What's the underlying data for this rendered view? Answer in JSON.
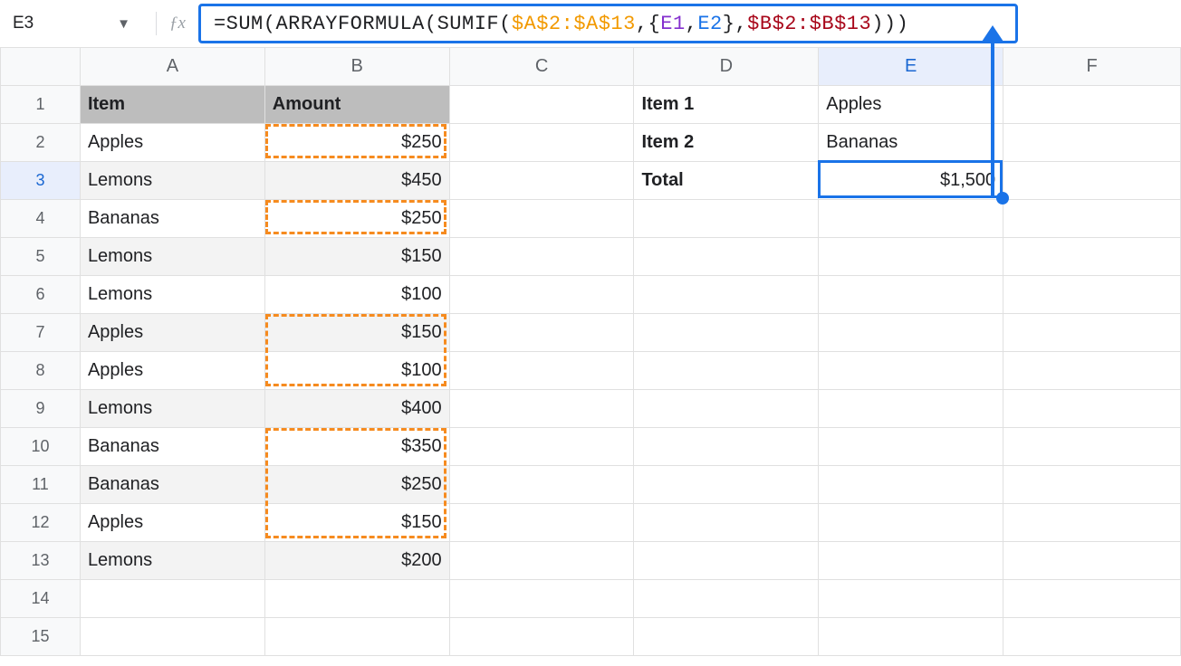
{
  "namebox": {
    "cell": "E3",
    "dropdown": "▼"
  },
  "formula": {
    "eq": "=",
    "sum": "SUM",
    "lp1": "(",
    "af": "ARRAYFORMULA",
    "lp2": "(",
    "sumif": "SUMIF",
    "lp3": "(",
    "r1": "$A$2:$A$13",
    "c1": ",",
    "sp1": " ",
    "lb": "{",
    "r2": "E1",
    "c2": ",",
    "r3": "E2",
    "rb": "}",
    "c3": ",",
    "sp2": " ",
    "r4": "$B$2:$B$13",
    "rp": ")))"
  },
  "columns": [
    "A",
    "B",
    "C",
    "D",
    "E",
    "F"
  ],
  "rowNumbers": [
    "1",
    "2",
    "3",
    "4",
    "5",
    "6",
    "7",
    "8",
    "9",
    "10",
    "11",
    "12",
    "13",
    "14",
    "15"
  ],
  "headers": {
    "item": "Item",
    "amount": "Amount"
  },
  "sidebarLabels": {
    "item1": "Item 1",
    "item2": "Item 2",
    "total": "Total"
  },
  "sidebarValues": {
    "item1": "Apples",
    "item2": "Bananas",
    "total": "$1,500"
  },
  "data": [
    {
      "item": "Apples",
      "amount": "$250",
      "shade": false,
      "dash": true
    },
    {
      "item": "Lemons",
      "amount": "$450",
      "shade": true,
      "dash": false
    },
    {
      "item": "Bananas",
      "amount": "$250",
      "shade": false,
      "dash": true
    },
    {
      "item": "Lemons",
      "amount": "$150",
      "shade": true,
      "dash": false
    },
    {
      "item": "Lemons",
      "amount": "$100",
      "shade": false,
      "dash": false
    },
    {
      "item": "Apples",
      "amount": "$150",
      "shade": true,
      "dash": true
    },
    {
      "item": "Apples",
      "amount": "$100",
      "shade": false,
      "dash": true
    },
    {
      "item": "Lemons",
      "amount": "$400",
      "shade": true,
      "dash": false
    },
    {
      "item": "Bananas",
      "amount": "$350",
      "shade": false,
      "dash": true
    },
    {
      "item": "Bananas",
      "amount": "$250",
      "shade": true,
      "dash": true
    },
    {
      "item": "Apples",
      "amount": "$150",
      "shade": false,
      "dash": true
    },
    {
      "item": "Lemons",
      "amount": "$200",
      "shade": true,
      "dash": false
    }
  ],
  "activeColIndex": 4,
  "activeRowIndex": 2
}
